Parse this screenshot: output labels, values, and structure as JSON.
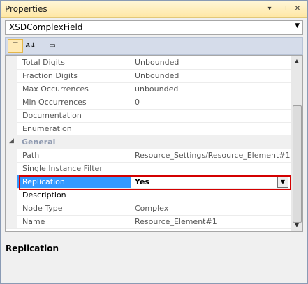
{
  "window": {
    "title": "Properties",
    "buttons": [
      {
        "name": "dropdown-window-button",
        "glyph": "▼"
      },
      {
        "name": "pin-window-button",
        "glyph": "📌"
      },
      {
        "name": "close-window-button",
        "glyph": "✕"
      }
    ]
  },
  "object_selector": {
    "value": "XSDComplexField"
  },
  "toolbar": {
    "categorized_icon": "categorized-icon",
    "alphabetical_icon": "alphabetical-icon",
    "property_pages_icon": "property-pages-icon"
  },
  "grid": {
    "rows_top": [
      {
        "name": "Total Digits",
        "value": "Unbounded"
      },
      {
        "name": "Fraction Digits",
        "value": "Unbounded"
      },
      {
        "name": "Max Occurrences",
        "value": "unbounded"
      },
      {
        "name": "Min Occurrences",
        "value": "0"
      },
      {
        "name": "Documentation",
        "value": ""
      },
      {
        "name": "Enumeration",
        "value": ""
      }
    ],
    "category": {
      "glyph": "◢",
      "name": "General"
    },
    "rows_general": [
      {
        "name": "Path",
        "value": "Resource_Settings/Resource_Element#1"
      },
      {
        "name": "Single Instance Filter",
        "value": ""
      },
      {
        "name": "Replication",
        "value": "Yes",
        "selected": true
      },
      {
        "name": "Description",
        "value": ""
      },
      {
        "name": "Node Type",
        "value": "Complex"
      },
      {
        "name": "Name",
        "value": "Resource_Element#1"
      }
    ]
  },
  "description_panel": {
    "title": "Replication"
  }
}
